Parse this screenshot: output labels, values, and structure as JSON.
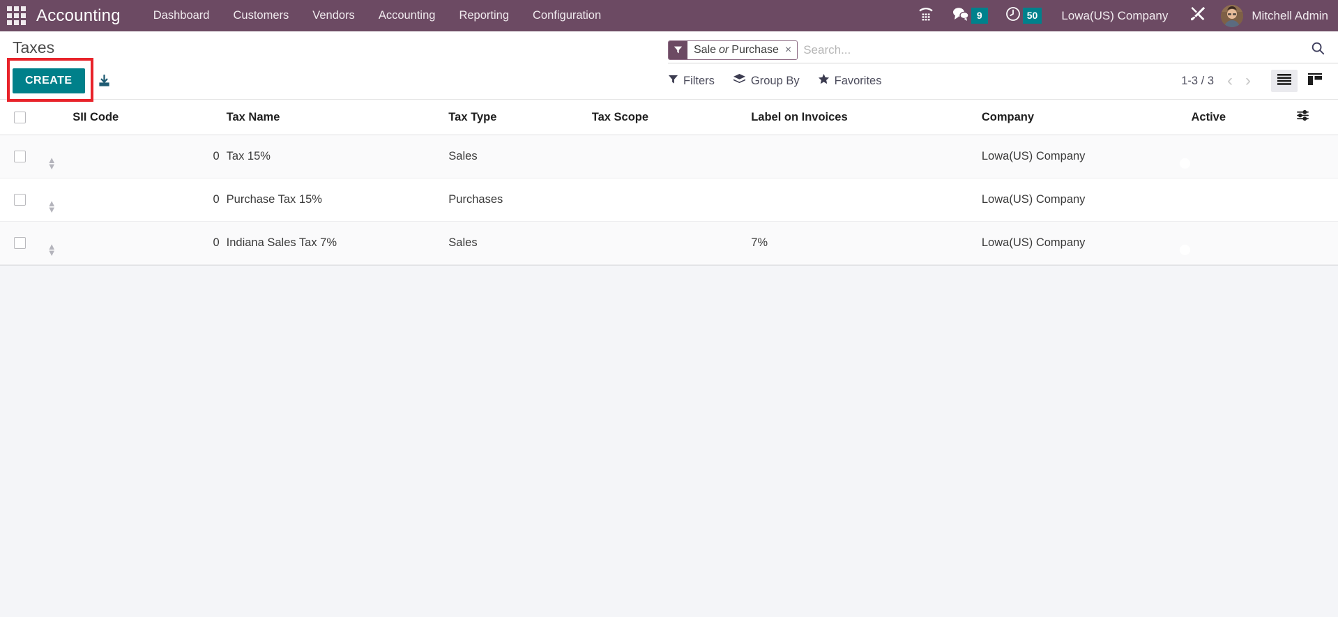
{
  "navbar": {
    "apps_icon": "apps-grid-icon",
    "brand": "Accounting",
    "menu": [
      {
        "label": "Dashboard"
      },
      {
        "label": "Customers"
      },
      {
        "label": "Vendors"
      },
      {
        "label": "Accounting"
      },
      {
        "label": "Reporting"
      },
      {
        "label": "Configuration"
      }
    ],
    "phone_icon": "phone-dialpad-icon",
    "messages_icon": "chat-bubble-icon",
    "messages_count": "9",
    "activities_icon": "clock-icon",
    "activities_count": "50",
    "company": "Lowa(US) Company",
    "tools_icon": "tools-icon",
    "avatar": "avatar",
    "user": "Mitchell Admin"
  },
  "control_panel": {
    "title": "Taxes",
    "create_label": "CREATE",
    "import_icon": "import-download-icon",
    "search": {
      "facet_icon": "filter-funnel-icon",
      "facet_pre": "Sale",
      "facet_em": "or",
      "facet_post": "Purchase",
      "facet_remove": "×",
      "placeholder": "Search...",
      "value": "",
      "magnifier_icon": "search-icon"
    },
    "tools": [
      {
        "label": "Filters",
        "icon": "filter-funnel-icon"
      },
      {
        "label": "Group By",
        "icon": "layers-icon"
      },
      {
        "label": "Favorites",
        "icon": "star-icon"
      }
    ],
    "pager": "1-3 / 3",
    "pager_prev": "‹",
    "pager_next": "›",
    "views": [
      {
        "name": "list-view",
        "icon": "list-icon",
        "active": true
      },
      {
        "name": "kanban-view",
        "icon": "kanban-icon",
        "active": false
      }
    ]
  },
  "table": {
    "columns": [
      {
        "key": "sii",
        "label": "SII Code"
      },
      {
        "key": "name",
        "label": "Tax Name"
      },
      {
        "key": "type",
        "label": "Tax Type"
      },
      {
        "key": "scope",
        "label": "Tax Scope"
      },
      {
        "key": "label",
        "label": "Label on Invoices"
      },
      {
        "key": "company",
        "label": "Company"
      },
      {
        "key": "active",
        "label": "Active"
      }
    ],
    "optional_columns_icon": "column-options-icon",
    "rows": [
      {
        "sii": "0",
        "name": "Tax 15%",
        "type": "Sales",
        "scope": "",
        "label": "",
        "company": "Lowa(US) Company",
        "active": true
      },
      {
        "sii": "0",
        "name": "Purchase Tax 15%",
        "type": "Purchases",
        "scope": "",
        "label": "",
        "company": "Lowa(US) Company",
        "active": true
      },
      {
        "sii": "0",
        "name": "Indiana Sales Tax 7%",
        "type": "Sales",
        "scope": "",
        "label": "7%",
        "company": "Lowa(US) Company",
        "active": true
      }
    ]
  },
  "colors": {
    "navbar": "#6C4A63",
    "accent_teal": "#00808A",
    "highlight_red": "#E8232A",
    "page_bg": "#F4F5F8"
  }
}
